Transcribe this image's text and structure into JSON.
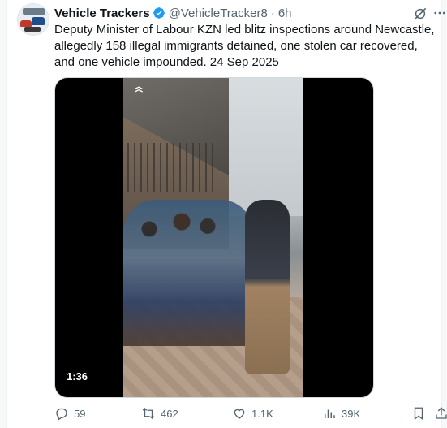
{
  "tweet": {
    "author_name": "Vehicle Trackers",
    "handle": "@VehicleTracker8",
    "separator": "·",
    "time": "6h",
    "text": "Deputy Minister of Labour KZN led blitz inspections around Newcastle, allegedly 158 illegal immigrants detained, one stolen car recovered, and one vehicle impounded. 24 Sep 2025"
  },
  "media": {
    "duration": "1:36"
  },
  "actions": {
    "replies": "59",
    "reposts": "462",
    "likes": "1.1K",
    "views": "39K"
  },
  "icons": [
    "verified-badge-icon",
    "grok-icon",
    "more-icon",
    "reply-icon",
    "repost-icon",
    "like-icon",
    "views-icon",
    "bookmark-icon",
    "share-icon"
  ],
  "colors": {
    "verified": "#1d9bf0",
    "secondary_text": "#536471",
    "primary_text": "#0f1419"
  }
}
